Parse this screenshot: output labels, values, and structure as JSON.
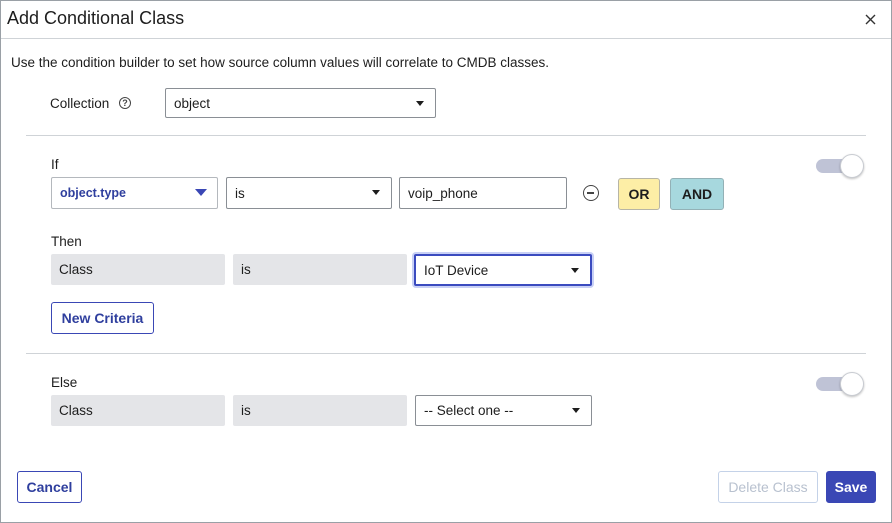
{
  "dialog": {
    "title": "Add Conditional Class",
    "description": "Use the condition builder to set how source column values will correlate to CMDB classes."
  },
  "collection": {
    "label": "Collection",
    "help_glyph": "?",
    "value": "object"
  },
  "if_section": {
    "label": "If",
    "field": "object.type",
    "operator": "is",
    "value": "voip_phone",
    "or_label": "OR",
    "and_label": "AND",
    "toggle_on": true
  },
  "then_section": {
    "label": "Then",
    "target": "Class",
    "operator": "is",
    "value": "IoT Device",
    "new_criteria_label": "New Criteria"
  },
  "else_section": {
    "label": "Else",
    "target": "Class",
    "operator": "is",
    "value": "-- Select one --",
    "toggle_on": true
  },
  "footer": {
    "cancel_label": "Cancel",
    "delete_label": "Delete Class",
    "save_label": "Save"
  }
}
